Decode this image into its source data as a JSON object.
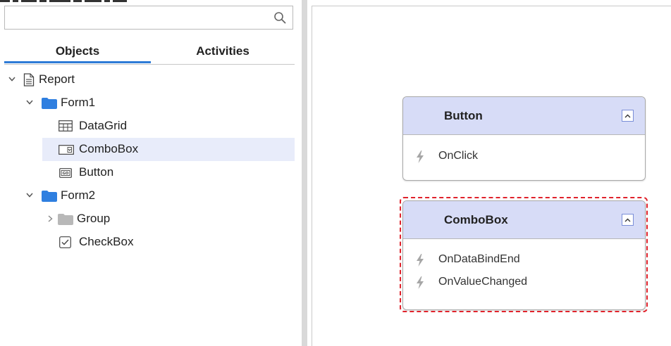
{
  "search": {
    "placeholder": "",
    "value": ""
  },
  "tabs": [
    {
      "label": "Objects",
      "active": true
    },
    {
      "label": "Activities",
      "active": false
    }
  ],
  "tree": [
    {
      "label": "Report",
      "icon": "document-icon",
      "expanded": true
    },
    {
      "label": "Form1",
      "icon": "folder-icon",
      "expanded": true
    },
    {
      "label": "DataGrid",
      "icon": "datagrid-icon"
    },
    {
      "label": "ComboBox",
      "icon": "combobox-icon",
      "selected": true
    },
    {
      "label": "Button",
      "icon": "button-icon"
    },
    {
      "label": "Form2",
      "icon": "folder-icon",
      "expanded": true
    },
    {
      "label": "Group",
      "icon": "folder-icon",
      "expanded": false
    },
    {
      "label": "CheckBox",
      "icon": "checkbox-icon"
    }
  ],
  "cards": [
    {
      "title": "Button",
      "events": [
        "OnClick"
      ]
    },
    {
      "title": "ComboBox",
      "events": [
        "OnDataBindEnd",
        "OnValueChanged"
      ],
      "selected": true
    }
  ],
  "colors": {
    "accent": "#2e7bd6",
    "folder": "#2f7fe0",
    "folder_collapsed": "#b8b8b8",
    "selected_row": "#e8ecfa",
    "card_header": "#d7dcf7",
    "selection_outline": "#e0222b"
  }
}
